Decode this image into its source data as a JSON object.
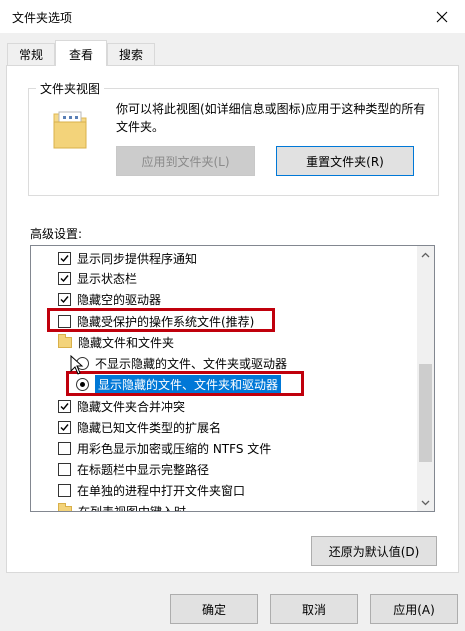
{
  "window": {
    "title": "文件夹选项"
  },
  "tabs": [
    {
      "label": "常规"
    },
    {
      "label": "查看"
    },
    {
      "label": "搜索"
    }
  ],
  "folder_views": {
    "group_title": "文件夹视图",
    "description": "你可以将此视图(如详细信息或图标)应用于这种类型的所有文件夹。",
    "apply_button": "应用到文件夹(L)",
    "reset_button": "重置文件夹(R)"
  },
  "advanced": {
    "label": "高级设置:",
    "items": [
      {
        "type": "checkbox",
        "checked": true,
        "label": "显示同步提供程序通知"
      },
      {
        "type": "checkbox",
        "checked": true,
        "label": "显示状态栏"
      },
      {
        "type": "checkbox",
        "checked": true,
        "label": "隐藏空的驱动器"
      },
      {
        "type": "checkbox",
        "checked": false,
        "label": "隐藏受保护的操作系统文件(推荐)"
      },
      {
        "type": "folder",
        "label": "隐藏文件和文件夹"
      },
      {
        "type": "radio",
        "checked": false,
        "label": "不显示隐藏的文件、文件夹或驱动器"
      },
      {
        "type": "radio",
        "checked": true,
        "label": "显示隐藏的文件、文件夹和驱动器"
      },
      {
        "type": "checkbox",
        "checked": true,
        "label": "隐藏文件夹合并冲突"
      },
      {
        "type": "checkbox",
        "checked": true,
        "label": "隐藏已知文件类型的扩展名"
      },
      {
        "type": "checkbox",
        "checked": false,
        "label": "用彩色显示加密或压缩的 NTFS 文件"
      },
      {
        "type": "checkbox",
        "checked": false,
        "label": "在标题栏中显示完整路径"
      },
      {
        "type": "checkbox",
        "checked": false,
        "label": "在单独的进程中打开文件夹窗口"
      },
      {
        "type": "folder",
        "label": "在列表视图中键入时"
      }
    ],
    "restore_button": "还原为默认值(D)"
  },
  "footer": {
    "ok": "确定",
    "cancel": "取消",
    "apply": "应用(A)"
  },
  "colors": {
    "highlight": "#c0000c",
    "selection": "#0078d7"
  }
}
